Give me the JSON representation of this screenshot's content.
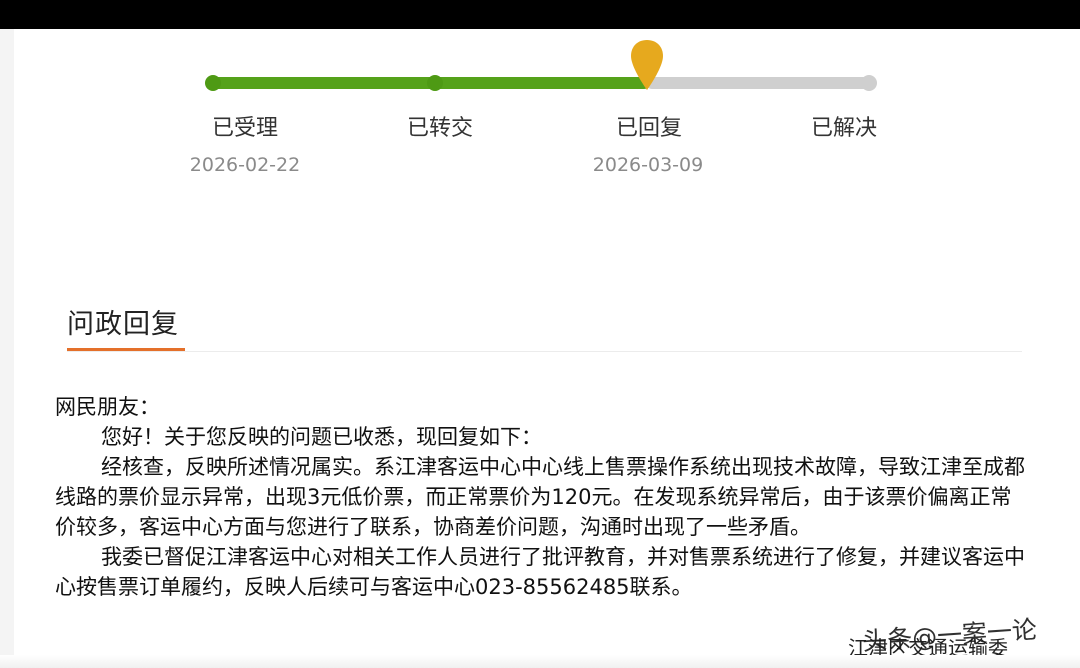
{
  "progress": {
    "completion": 0.67,
    "steps": [
      {
        "label": "已受理",
        "date": "2026-02-22",
        "status": "done"
      },
      {
        "label": "已转交",
        "date": "",
        "status": "done"
      },
      {
        "label": "已回复",
        "date": "2026-03-09",
        "status": "current"
      },
      {
        "label": "已解决",
        "date": "",
        "status": "pending"
      }
    ],
    "colors": {
      "done": "#55a21a",
      "pending": "#cfcfcf",
      "marker": "#e6a91e"
    }
  },
  "section": {
    "title": "问政回复",
    "accent_color": "#e4702a"
  },
  "reply": {
    "salutation": "网民朋友：",
    "paragraphs": [
      "您好！关于您反映的问题已收悉，现回复如下：",
      "经核查，反映所述情况属实。系江津客运中心中心线上售票操作系统出现技术故障，导致江津至成都线路的票价显示异常，出现3元低价票，而正常票价为120元。在发现系统异常后，由于该票价偏离正常价较多，客运中心方面与您进行了联系，协商差价问题，沟通时出现了一些矛盾。",
      "我委已督促江津客运中心对相关工作人员进行了批评教育，并对售票系统进行了修复，并建议客运中心按售票订单履约，反映人后续可与客运中心023-85562485联系。"
    ],
    "signoff": "江津区交通运输委"
  },
  "watermark": "头条@一案一论"
}
